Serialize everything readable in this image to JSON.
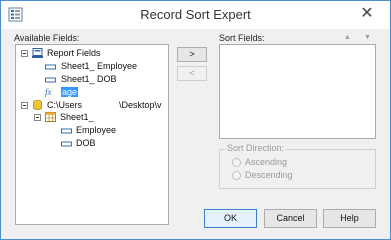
{
  "window": {
    "title": "Record Sort Expert",
    "close_symbol": "✕"
  },
  "available": {
    "label": "Available Fields:",
    "tree": {
      "report_fields": "Report Fields",
      "employee": "Sheet1_ Employee",
      "dob": "Sheet1_ DOB",
      "age": "age",
      "path_start": "C:\\Users",
      "path_end": "\\Desktop\\v",
      "sheet": "Sheet1_",
      "sub_employee": "Employee",
      "sub_dob": "DOB"
    }
  },
  "move": {
    "add": ">",
    "remove": "<"
  },
  "sort": {
    "label": "Sort Fields:",
    "up": "▲",
    "down": "▼"
  },
  "direction": {
    "legend": "Sort Direction:",
    "ascending": "Ascending",
    "descending": "Descending"
  },
  "buttons": {
    "ok": "OK",
    "cancel": "Cancel",
    "help": "Help"
  },
  "icons": {
    "app": "sort-expert-icon",
    "formula": "fx-icon"
  },
  "colors": {
    "accent": "#3399ff",
    "border": "#4a8fd6"
  }
}
